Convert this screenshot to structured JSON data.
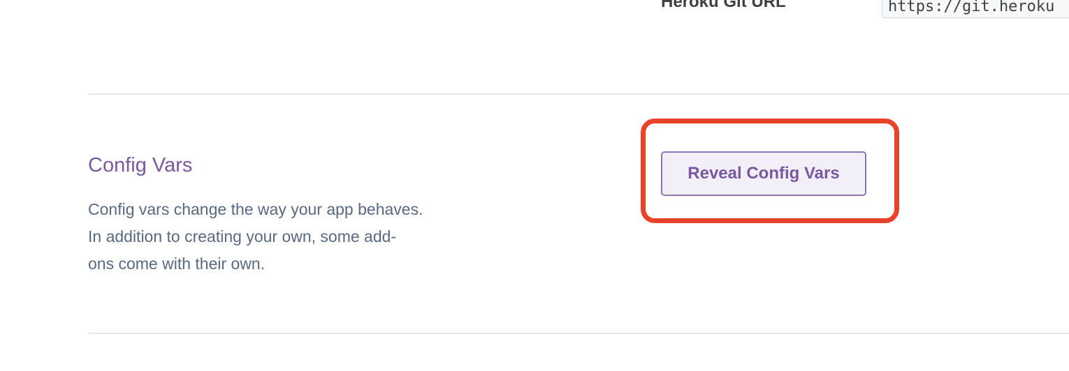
{
  "deploy": {
    "git_url_label": "Heroku Git URL",
    "git_url_value": "https://git.heroku"
  },
  "config_vars": {
    "title": "Config Vars",
    "description_lines": [
      "Config vars change the way your app behaves.",
      "In addition to creating your own, some add-",
      "ons come with their own."
    ],
    "reveal_button_label": "Reveal Config Vars"
  },
  "colors": {
    "accent_purple": "#79589f",
    "highlight_red": "#e8432a",
    "body_text": "#596981",
    "divider": "#e7e9ee"
  }
}
